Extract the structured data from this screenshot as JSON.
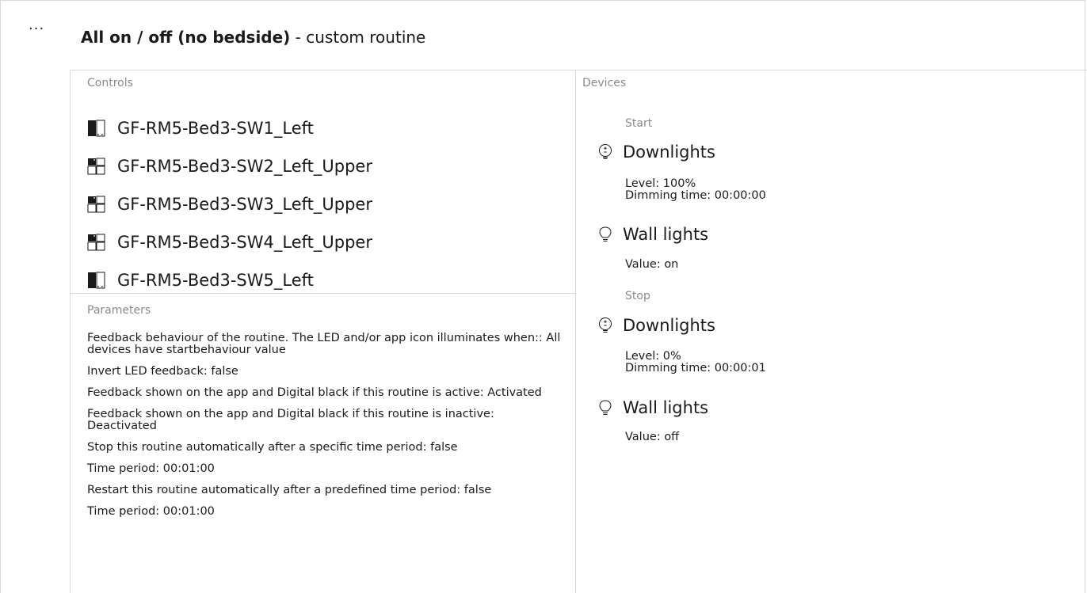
{
  "header": {
    "menu_icon": "ellipsis-icon",
    "menu_label": "···",
    "title": "All on / off (no bedside)",
    "separator": " - ",
    "subtitle": "custom routine"
  },
  "controls": {
    "label": "Controls",
    "items": [
      {
        "name": "GF-RM5-Bed3-SW1_Left",
        "icon": "single-switch-icon"
      },
      {
        "name": "GF-RM5-Bed3-SW2_Left_Upper",
        "icon": "quad-switch-icon"
      },
      {
        "name": "GF-RM5-Bed3-SW3_Left_Upper",
        "icon": "quad-switch-icon"
      },
      {
        "name": "GF-RM5-Bed3-SW4_Left_Upper",
        "icon": "quad-switch-icon"
      },
      {
        "name": "GF-RM5-Bed3-SW5_Left",
        "icon": "single-switch-icon"
      }
    ]
  },
  "parameters": {
    "label": "Parameters",
    "items": [
      "Feedback behaviour of the routine. The LED and/or app icon illuminates when:: All devices have startbehaviour value",
      "Invert LED feedback: false",
      "Feedback shown on the app and Digital black if this routine is active: Activated",
      "Feedback shown on the app and Digital black if this routine is inactive: Deactivated",
      "Stop this routine automatically after a specific time period: false",
      "Time period: 00:01:00",
      "Restart this routine automatically after a predefined time period: false",
      "Time period: 00:01:00"
    ]
  },
  "devices": {
    "label": "Devices",
    "start": {
      "label": "Start",
      "items": [
        {
          "name": "Downlights",
          "icon": "dimmable-bulb-icon",
          "details": [
            "Level: 100%",
            "Dimming time: 00:00:00"
          ]
        },
        {
          "name": "Wall lights",
          "icon": "bulb-icon",
          "details": [
            "Value: on"
          ]
        }
      ]
    },
    "stop": {
      "label": "Stop",
      "items": [
        {
          "name": "Downlights",
          "icon": "dimmable-bulb-icon",
          "details": [
            "Level: 0%",
            "Dimming time: 00:00:01"
          ]
        },
        {
          "name": "Wall lights",
          "icon": "bulb-icon",
          "details": [
            "Value: off"
          ]
        }
      ]
    }
  }
}
